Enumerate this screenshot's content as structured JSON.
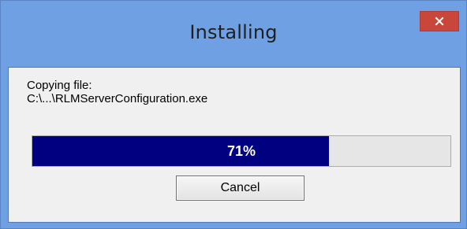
{
  "window": {
    "title": "Installing",
    "close_icon": "close-icon",
    "accent_color": "#6fa0e3",
    "close_color": "#c9473a"
  },
  "status": {
    "label": "Copying file:",
    "path": "C:\\...\\RLMServerConfiguration.exe"
  },
  "progress": {
    "value": 71,
    "label": "71%",
    "fill_color": "#000080"
  },
  "buttons": {
    "cancel_label": "Cancel"
  }
}
